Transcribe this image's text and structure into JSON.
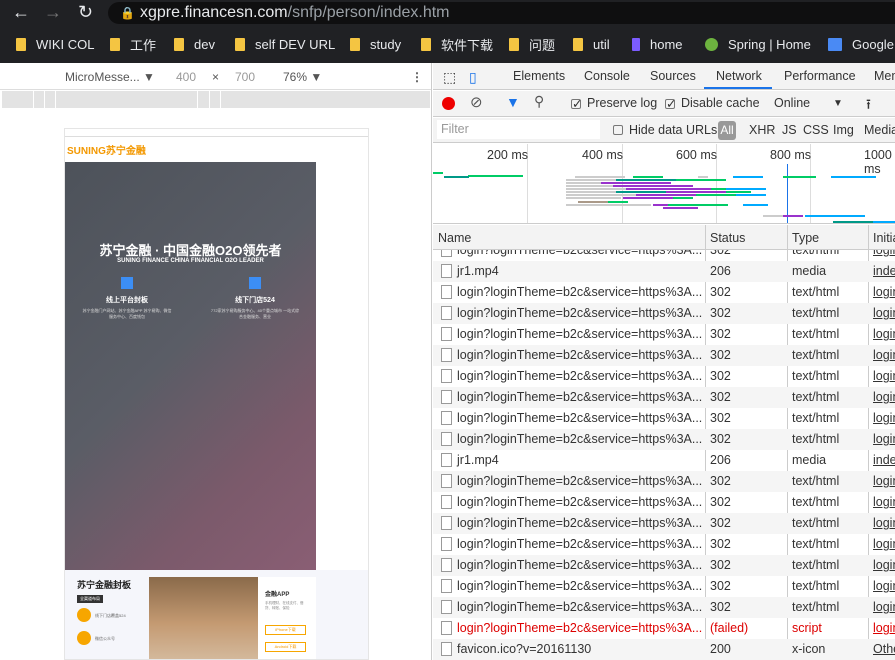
{
  "browser": {
    "url_host": "xgpre.financesn.com",
    "url_path": "/snfp/person/index.htm",
    "bookmarks": [
      {
        "label": "WIKI COL",
        "icon": "folder-icon"
      },
      {
        "label": "工作",
        "icon": "folder-icon"
      },
      {
        "label": "dev",
        "icon": "folder-icon"
      },
      {
        "label": "self DEV URL",
        "icon": "folder-icon"
      },
      {
        "label": "study",
        "icon": "folder-icon"
      },
      {
        "label": "软件下载",
        "icon": "folder-icon"
      },
      {
        "label": "问题",
        "icon": "folder-icon"
      },
      {
        "label": "util",
        "icon": "folder-icon"
      },
      {
        "label": "home",
        "icon": "bracket-icon"
      },
      {
        "label": "Spring | Home",
        "icon": "spring-icon"
      },
      {
        "label": "Google",
        "icon": "google-translate-icon"
      }
    ]
  },
  "device": {
    "name": "MicroMesse...",
    "width": "400",
    "x": "×",
    "height": "700",
    "zoom": "76%"
  },
  "page": {
    "logo": "SUNING苏宁金融",
    "hero_title": "苏宁金融 · 中国金融O2O领先者",
    "hero_sub": "SUNING FINANCE CHINA FINANCIAL O2O LEADER",
    "feat1_title": "线上平台封板",
    "feat1_desc": "苏宁金融门户网站、苏宁金融APP 苏宁易购、微信服务中心、百度钱包",
    "feat2_title": "线下门店524",
    "feat2_desc": "772家苏宁易购服务中心、40个重点城市 一站式综合金融服务、营业",
    "section_title": "苏宁金融封板",
    "section_badge": "全渠道布局",
    "item1": "线下门店覆盖524",
    "item2": "微信公众号",
    "app_title": "金融APP",
    "app_desc": "手机理财、在线支付、借贷、转账、保险",
    "iphone": "iPhone下载",
    "android": "Android下载"
  },
  "devtools": {
    "tabs": [
      "Elements",
      "Console",
      "Sources",
      "Network",
      "Performance",
      "Mem"
    ],
    "active_tab": "Network",
    "preserve_log": "Preserve log",
    "disable_cache": "Disable cache",
    "throttle": "Online",
    "filter_placeholder": "Filter",
    "hide_data_urls": "Hide data URLs",
    "filter_types": [
      "All",
      "XHR",
      "JS",
      "CSS",
      "Img",
      "Media"
    ],
    "ticks": [
      "200 ms",
      "400 ms",
      "600 ms",
      "800 ms",
      "1000 ms"
    ],
    "columns": [
      "Name",
      "Status",
      "Type",
      "Initiator"
    ],
    "rows": [
      {
        "name": "login?loginTheme=b2c&service=https%3A...",
        "status": "302",
        "type": "text/html",
        "initiator": "login"
      },
      {
        "name": "jr1.mp4",
        "status": "206",
        "type": "media",
        "initiator": "inde"
      },
      {
        "name": "login?loginTheme=b2c&service=https%3A...",
        "status": "302",
        "type": "text/html",
        "initiator": "login"
      },
      {
        "name": "login?loginTheme=b2c&service=https%3A...",
        "status": "302",
        "type": "text/html",
        "initiator": "login"
      },
      {
        "name": "login?loginTheme=b2c&service=https%3A...",
        "status": "302",
        "type": "text/html",
        "initiator": "login"
      },
      {
        "name": "login?loginTheme=b2c&service=https%3A...",
        "status": "302",
        "type": "text/html",
        "initiator": "login"
      },
      {
        "name": "login?loginTheme=b2c&service=https%3A...",
        "status": "302",
        "type": "text/html",
        "initiator": "login"
      },
      {
        "name": "login?loginTheme=b2c&service=https%3A...",
        "status": "302",
        "type": "text/html",
        "initiator": "login"
      },
      {
        "name": "login?loginTheme=b2c&service=https%3A...",
        "status": "302",
        "type": "text/html",
        "initiator": "login"
      },
      {
        "name": "login?loginTheme=b2c&service=https%3A...",
        "status": "302",
        "type": "text/html",
        "initiator": "login"
      },
      {
        "name": "jr1.mp4",
        "status": "206",
        "type": "media",
        "initiator": "inde"
      },
      {
        "name": "login?loginTheme=b2c&service=https%3A...",
        "status": "302",
        "type": "text/html",
        "initiator": "login"
      },
      {
        "name": "login?loginTheme=b2c&service=https%3A...",
        "status": "302",
        "type": "text/html",
        "initiator": "login"
      },
      {
        "name": "login?loginTheme=b2c&service=https%3A...",
        "status": "302",
        "type": "text/html",
        "initiator": "login"
      },
      {
        "name": "login?loginTheme=b2c&service=https%3A...",
        "status": "302",
        "type": "text/html",
        "initiator": "login"
      },
      {
        "name": "login?loginTheme=b2c&service=https%3A...",
        "status": "302",
        "type": "text/html",
        "initiator": "login"
      },
      {
        "name": "login?loginTheme=b2c&service=https%3A...",
        "status": "302",
        "type": "text/html",
        "initiator": "login"
      },
      {
        "name": "login?loginTheme=b2c&service=https%3A...",
        "status": "302",
        "type": "text/html",
        "initiator": "login"
      },
      {
        "name": "login?loginTheme=b2c&service=https%3A...",
        "status": "(failed)",
        "type": "script",
        "initiator": "login",
        "failed": true
      },
      {
        "name": "favicon.ico?v=20161130",
        "status": "200",
        "type": "x-icon",
        "initiator": "Other"
      }
    ]
  }
}
